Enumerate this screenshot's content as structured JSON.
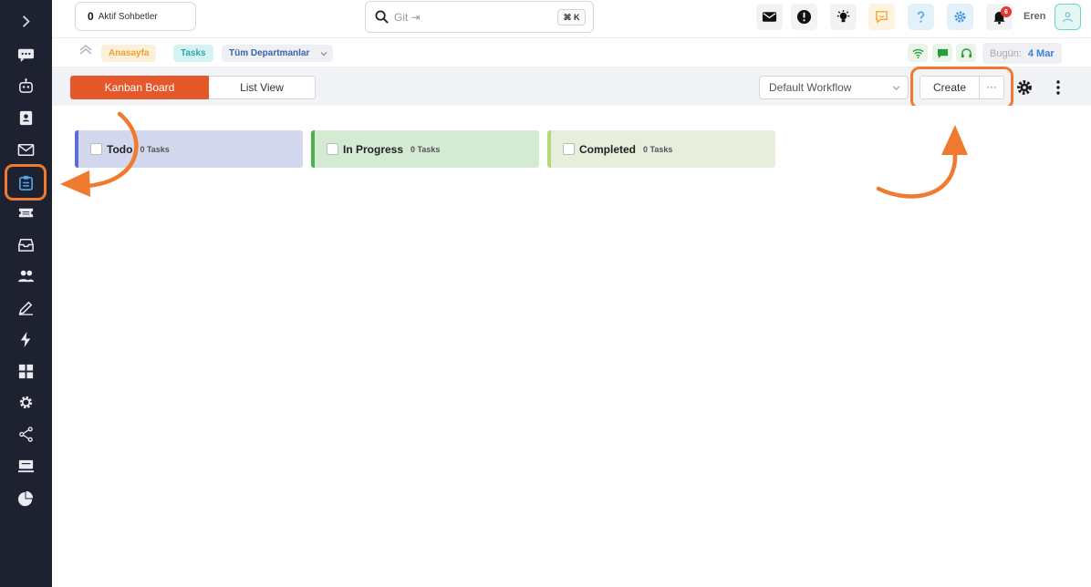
{
  "sidebar": {
    "items": [
      {
        "icon": "chevron-right-icon"
      },
      {
        "icon": "chat-bubbles-icon"
      },
      {
        "icon": "robot-icon"
      },
      {
        "icon": "contact-book-icon"
      },
      {
        "icon": "mail-icon"
      },
      {
        "icon": "clipboard-icon",
        "active": true
      },
      {
        "icon": "ticket-icon"
      },
      {
        "icon": "inbox-icon"
      },
      {
        "icon": "users-icon"
      },
      {
        "icon": "pen-icon"
      },
      {
        "icon": "lightning-icon"
      },
      {
        "icon": "grid-icon"
      },
      {
        "icon": "gear-icon"
      },
      {
        "icon": "share-icon"
      },
      {
        "icon": "monitor-icon"
      },
      {
        "icon": "pie-chart-icon"
      }
    ]
  },
  "topbar": {
    "active_chats_count": "0",
    "active_chats_label": "Aktif Sohbetler",
    "search_placeholder": "Git ⇥",
    "search_shortcut": "⌘ K",
    "notification_count": "6",
    "username": "Eren"
  },
  "breadcrumb": {
    "home": "Anasayfa",
    "tasks": "Tasks",
    "department": "Tüm Departmanlar",
    "today_label": "Bugün:",
    "today_value": "4 Mar"
  },
  "toolbar": {
    "kanban_label": "Kanban Board",
    "list_label": "List View",
    "workflow_label": "Default Workflow",
    "create_label": "Create",
    "more_label": "···"
  },
  "columns": [
    {
      "title": "Todo",
      "count": "0 Tasks"
    },
    {
      "title": "In Progress",
      "count": "0 Tasks"
    },
    {
      "title": "Completed",
      "count": "0 Tasks"
    }
  ],
  "colors": {
    "accent": "#e5582b",
    "annotation": "#f07a2f",
    "todo": "#5b6fd0",
    "in_progress": "#4cb04c",
    "completed": "#b4d97a"
  }
}
